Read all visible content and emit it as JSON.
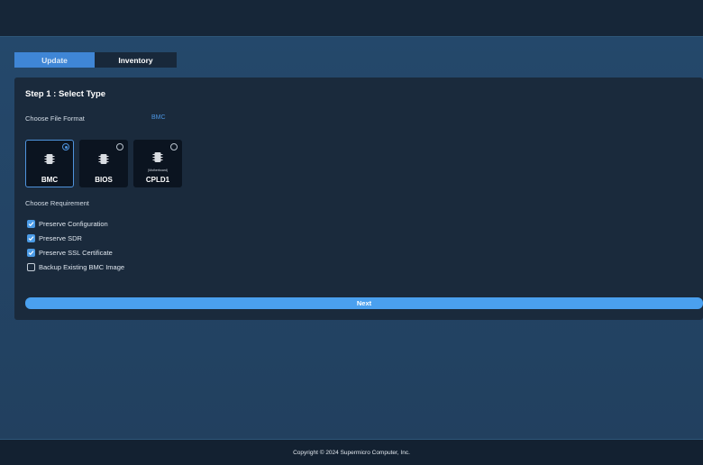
{
  "tabs": [
    {
      "label": "Update",
      "active": true
    },
    {
      "label": "Inventory",
      "active": false
    }
  ],
  "step": {
    "title": "Step 1 : Select Type"
  },
  "file_format": {
    "label": "Choose File Format",
    "value": "BMC"
  },
  "types": [
    {
      "label": "BMC",
      "sublabel": "",
      "selected": true,
      "icon": "chip-icon"
    },
    {
      "label": "BIOS",
      "sublabel": "",
      "selected": false,
      "icon": "chip-icon"
    },
    {
      "label": "CPLD1",
      "sublabel": "(Motherboard)",
      "selected": false,
      "icon": "chip-icon"
    }
  ],
  "requirements": {
    "label": "Choose Requirement",
    "items": [
      {
        "label": "Preserve Configuration",
        "checked": true
      },
      {
        "label": "Preserve SDR",
        "checked": true
      },
      {
        "label": "Preserve SSL Certificate",
        "checked": true
      },
      {
        "label": "Backup Existing BMC Image",
        "checked": false
      }
    ]
  },
  "actions": {
    "next_label": "Next"
  },
  "footer": {
    "copyright": "Copyright © 2024 Supermicro Computer, Inc."
  },
  "colors": {
    "accent": "#3f86d6",
    "button": "#4aa0ef",
    "card": "#1a2a3c",
    "background": "#22405f"
  }
}
